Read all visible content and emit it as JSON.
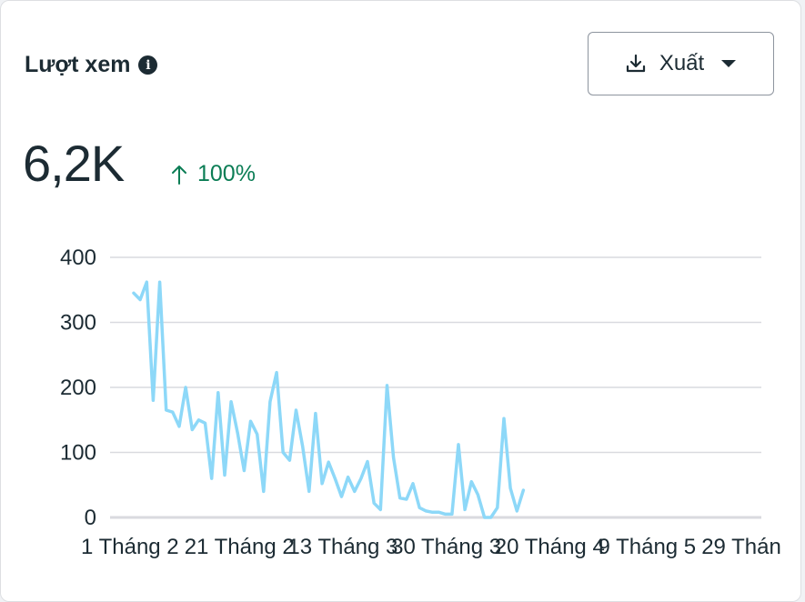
{
  "header": {
    "title": "Lượt xem",
    "info_icon": "info-icon",
    "export_label": "Xuất",
    "export_icon": "download-icon",
    "dropdown_icon": "caret-down-icon"
  },
  "summary": {
    "total": "6,2K",
    "change": "100%",
    "change_icon": "arrow-up-icon",
    "change_color": "#0b7d55"
  },
  "colors": {
    "line": "#8dd8f8",
    "grid": "#d9dadf",
    "text": "#1c2b33"
  },
  "chart_data": {
    "type": "line",
    "title": "",
    "xlabel": "",
    "ylabel": "",
    "ylim": [
      0,
      400
    ],
    "yticks": [
      "0",
      "100",
      "200",
      "300",
      "400"
    ],
    "xtick_labels": [
      "1 Tháng 2",
      "21 Tháng 2",
      "13 Tháng 3",
      "30 Tháng 3",
      "20 Tháng 4",
      "9 Tháng 5",
      "29 Thán"
    ],
    "grid": true,
    "series": [
      {
        "values": [
          345,
          335,
          362,
          180,
          362,
          165,
          162,
          140,
          200,
          135,
          150,
          145,
          60,
          192,
          65,
          178,
          130,
          72,
          148,
          128,
          40,
          178,
          223,
          100,
          88,
          165,
          110,
          40,
          160,
          52,
          85,
          60,
          32,
          62,
          40,
          60,
          86,
          22,
          12,
          203,
          92,
          30,
          28,
          52,
          15,
          10,
          8,
          8,
          5,
          5,
          112,
          12,
          55,
          35,
          0,
          0,
          15,
          152,
          45,
          10,
          42
        ]
      }
    ],
    "reference_line": {
      "index": 120,
      "style": "dotted"
    }
  }
}
